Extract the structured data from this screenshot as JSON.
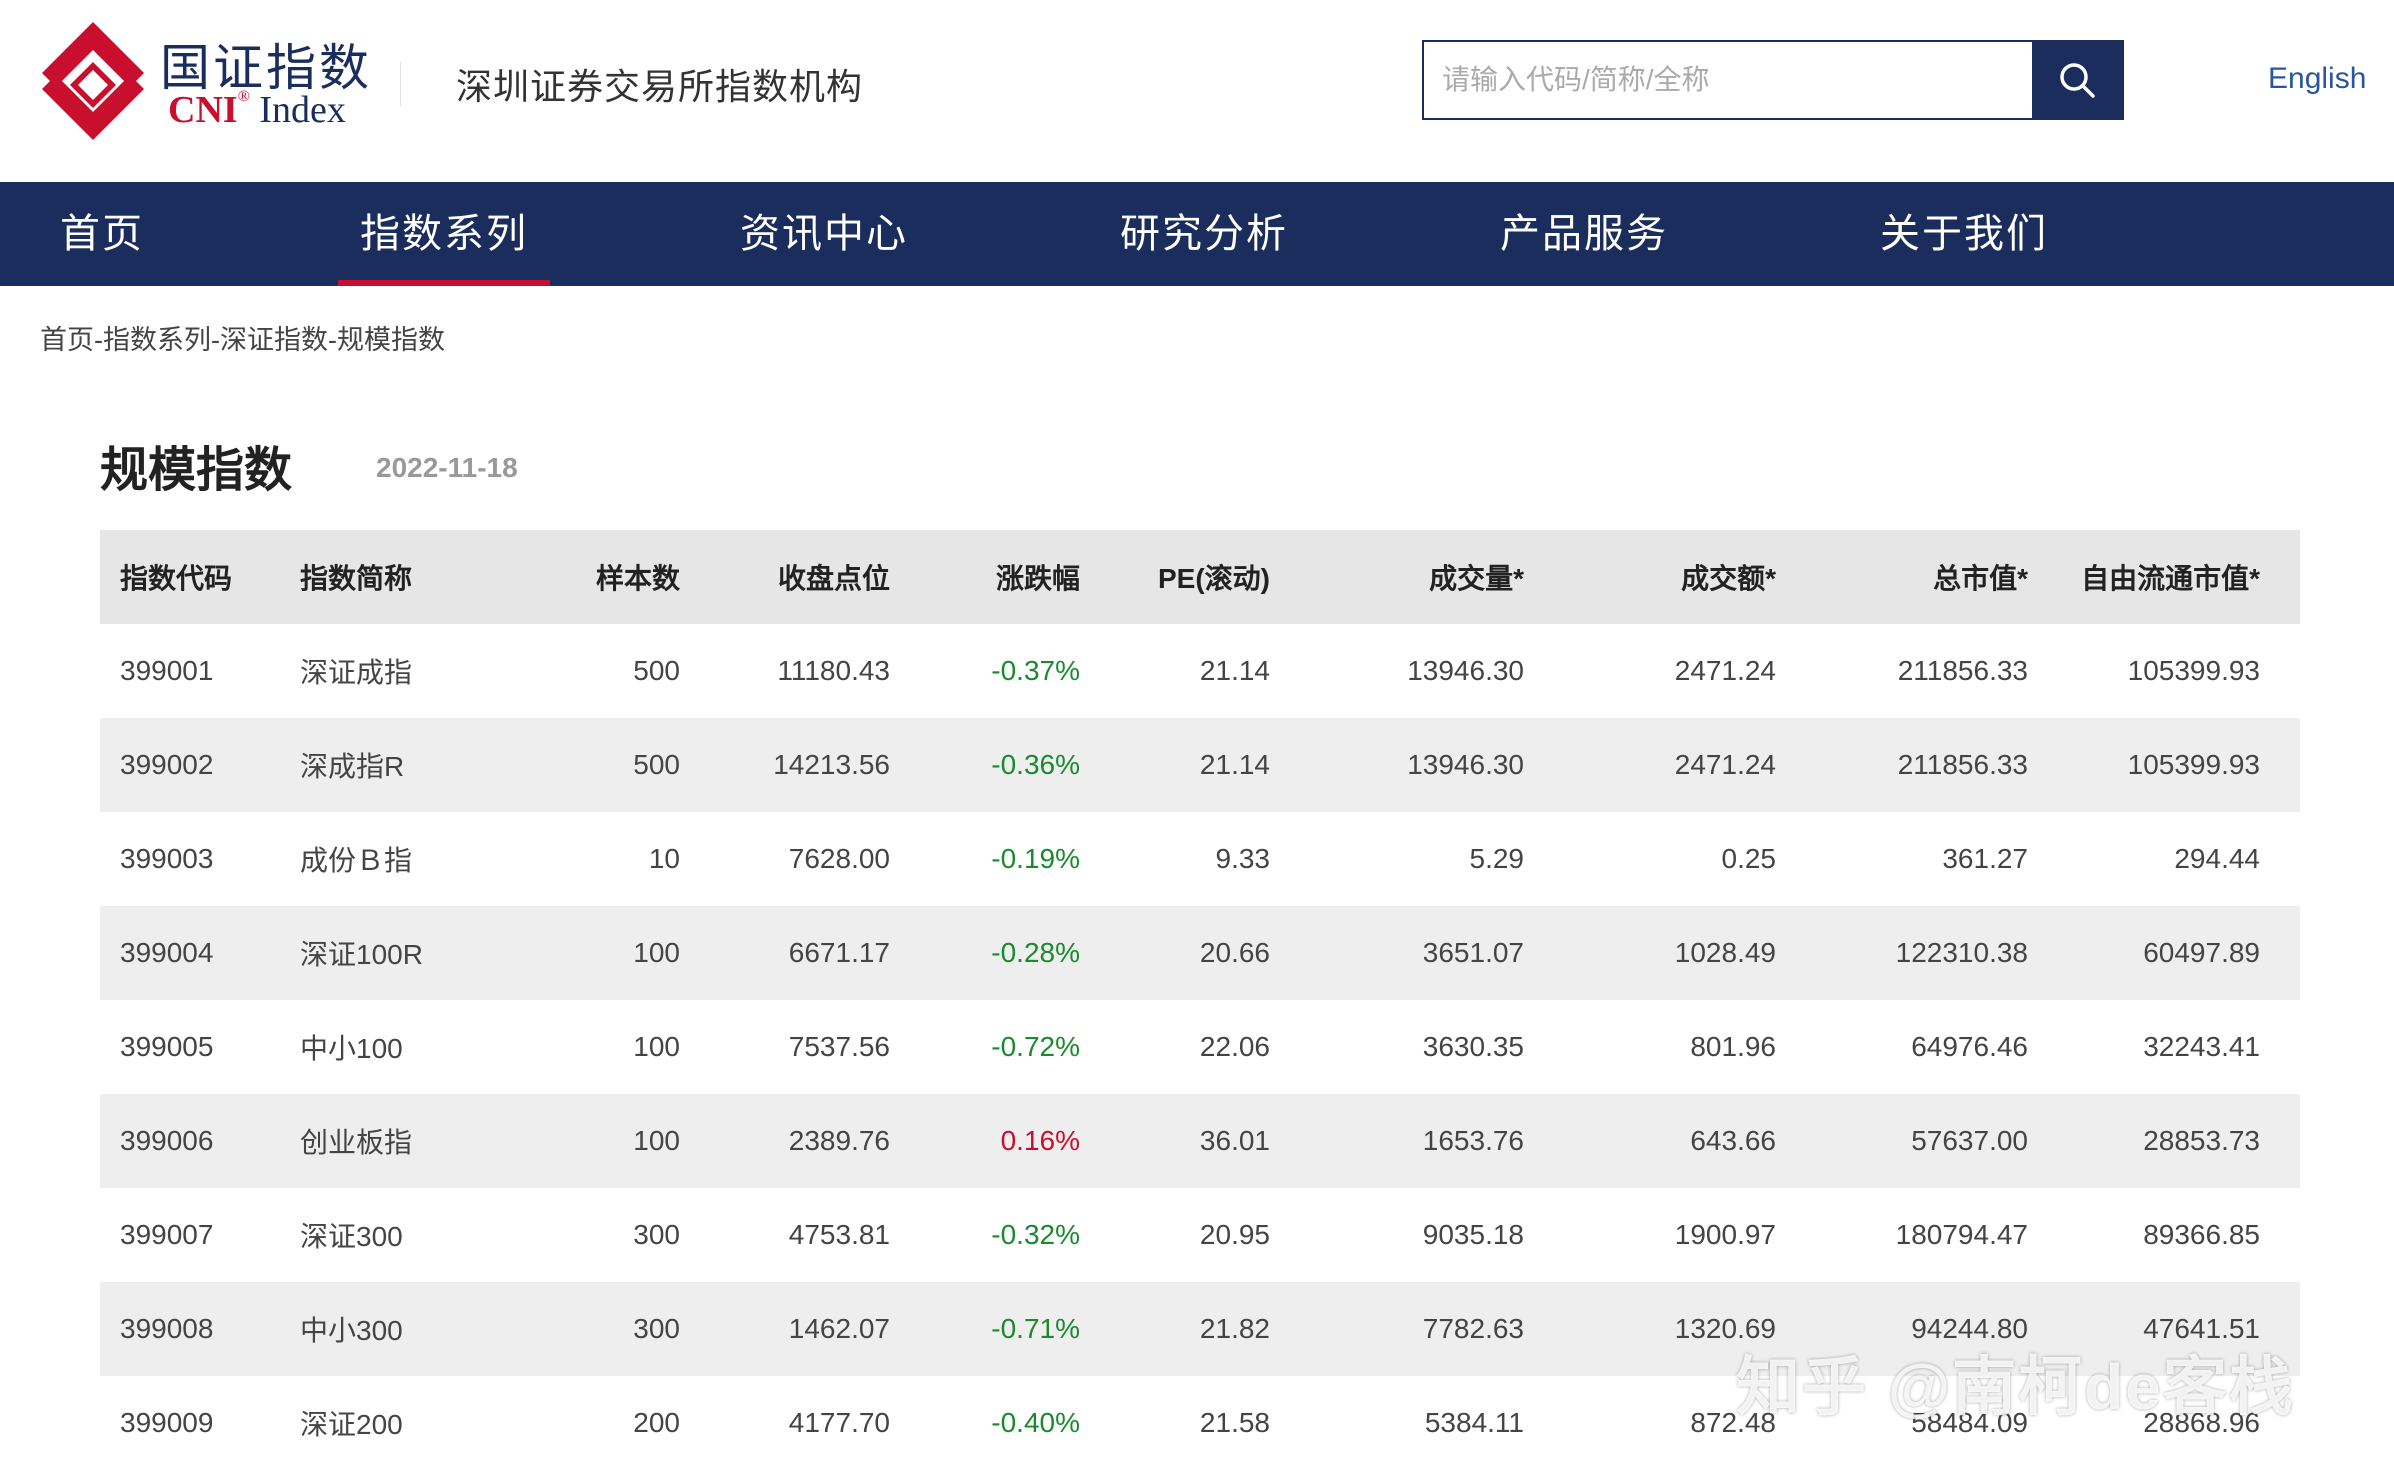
{
  "header": {
    "logo_cn": "国证指数",
    "logo_en_cni": "CNI",
    "logo_en_reg": "®",
    "logo_en_index": "Index",
    "tagline": "深圳证券交易所指数机构",
    "search_placeholder": "请输入代码/简称/全称",
    "language_link": "English",
    "colors": {
      "brand_navy": "#1a2d5c",
      "brand_red": "#c8102e",
      "link_blue": "#2a55a0"
    }
  },
  "nav": {
    "items": [
      {
        "label": "首页"
      },
      {
        "label": "指数系列",
        "active": true
      },
      {
        "label": "资讯中心"
      },
      {
        "label": "研究分析"
      },
      {
        "label": "产品服务"
      },
      {
        "label": "关于我们"
      }
    ]
  },
  "breadcrumb": "首页-指数系列-深证指数-规模指数",
  "page": {
    "title": "规模指数",
    "date": "2022-11-18"
  },
  "table": {
    "columns": [
      "指数代码",
      "指数简称",
      "样本数",
      "收盘点位",
      "涨跌幅",
      "PE(滚动)",
      "成交量*",
      "成交额*",
      "总市值*",
      "自由流通市值*"
    ],
    "rows": [
      [
        "399001",
        "深证成指",
        "500",
        "11180.43",
        "-0.37%",
        "21.14",
        "13946.30",
        "2471.24",
        "211856.33",
        "105399.93"
      ],
      [
        "399002",
        "深成指R",
        "500",
        "14213.56",
        "-0.36%",
        "21.14",
        "13946.30",
        "2471.24",
        "211856.33",
        "105399.93"
      ],
      [
        "399003",
        "成份Ｂ指",
        "10",
        "7628.00",
        "-0.19%",
        "9.33",
        "5.29",
        "0.25",
        "361.27",
        "294.44"
      ],
      [
        "399004",
        "深证100R",
        "100",
        "6671.17",
        "-0.28%",
        "20.66",
        "3651.07",
        "1028.49",
        "122310.38",
        "60497.89"
      ],
      [
        "399005",
        "中小100",
        "100",
        "7537.56",
        "-0.72%",
        "22.06",
        "3630.35",
        "801.96",
        "64976.46",
        "32243.41"
      ],
      [
        "399006",
        "创业板指",
        "100",
        "2389.76",
        "0.16%",
        "36.01",
        "1653.76",
        "643.66",
        "57637.00",
        "28853.73"
      ],
      [
        "399007",
        "深证300",
        "300",
        "4753.81",
        "-0.32%",
        "20.95",
        "9035.18",
        "1900.97",
        "180794.47",
        "89366.85"
      ],
      [
        "399008",
        "中小300",
        "300",
        "1462.07",
        "-0.71%",
        "21.82",
        "7782.63",
        "1320.69",
        "94244.80",
        "47641.51"
      ],
      [
        "399009",
        "深证200",
        "200",
        "4177.70",
        "-0.40%",
        "21.58",
        "5384.11",
        "872.48",
        "58484.09",
        "28868.96"
      ]
    ],
    "change_colors": {
      "negative": "#1a8a2e",
      "positive": "#c8102e"
    }
  },
  "watermark": "知乎 @南柯de客栈"
}
